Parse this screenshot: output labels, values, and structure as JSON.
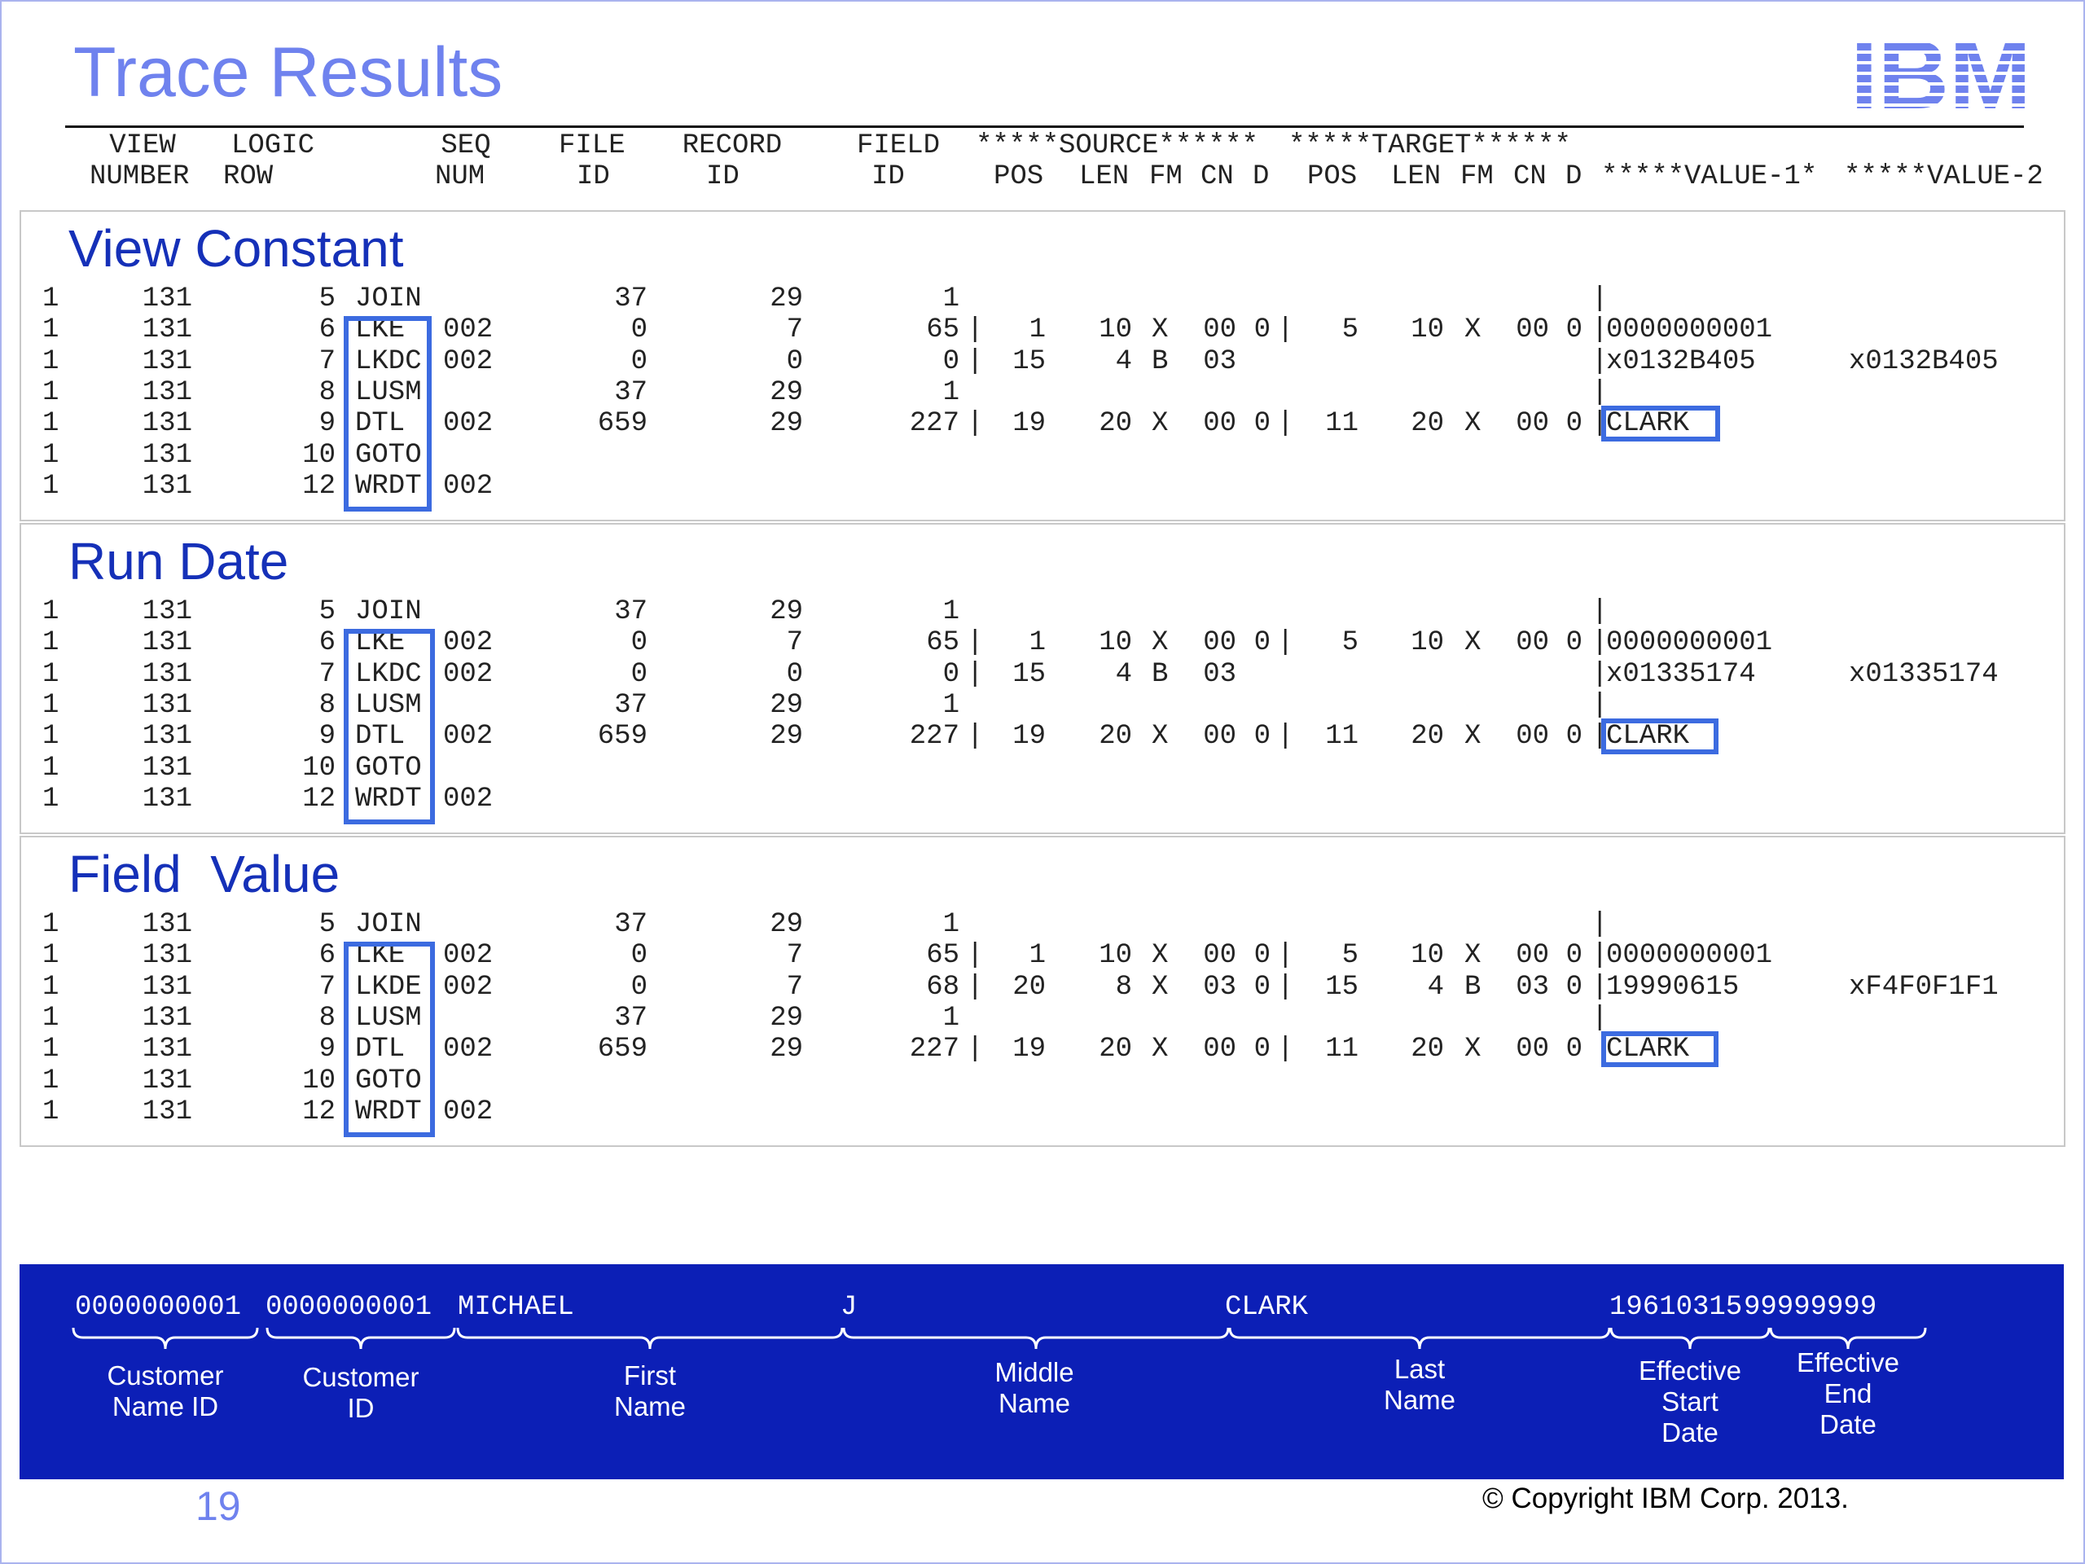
{
  "slide": {
    "title": "Trace Results",
    "logo_text": "IBM",
    "page_number": "19",
    "copyright": "© Copyright IBM Corp. 2013."
  },
  "columns": {
    "line1": [
      "VIEW",
      "LOGIC",
      "SEQ",
      "FILE",
      "RECORD",
      "FIELD",
      "*****SOURCE******",
      "*****TARGET******"
    ],
    "line2": [
      "NUMBER",
      "ROW",
      "NUM",
      "ID",
      "ID",
      "ID",
      "POS",
      "LEN",
      "FM",
      "CN",
      "D",
      "POS",
      "LEN",
      "FM",
      "CN",
      "D",
      "*****VALUE-1*",
      "*****VALUE-2"
    ]
  },
  "sections": [
    {
      "title": "View Constant",
      "rows": [
        {
          "view": "1",
          "row": "131",
          "seq": "5",
          "func": "JOIN",
          "lr": "",
          "file": "37",
          "rec": "29",
          "field": "1",
          "s_sep": "",
          "s_pos": "",
          "s_len": "",
          "s_fm": "",
          "s_cn": "",
          "s_d": "",
          "t_sep": "",
          "t_pos": "",
          "t_len": "",
          "t_fm": "",
          "t_cn": "",
          "t_d": "",
          "v_sep": "|",
          "value1": "",
          "value2": ""
        },
        {
          "view": "1",
          "row": "131",
          "seq": "6",
          "func": "LKE",
          "lr": "002",
          "file": "0",
          "rec": "7",
          "field": "65",
          "s_sep": "|",
          "s_pos": "1",
          "s_len": "10",
          "s_fm": "X",
          "s_cn": "00",
          "s_d": "0",
          "t_sep": "|",
          "t_pos": "5",
          "t_len": "10",
          "t_fm": "X",
          "t_cn": "00",
          "t_d": "0",
          "v_sep": "|",
          "value1": "0000000001",
          "value2": ""
        },
        {
          "view": "1",
          "row": "131",
          "seq": "7",
          "func": "LKDC",
          "lr": "002",
          "file": "0",
          "rec": "0",
          "field": "0",
          "s_sep": "|",
          "s_pos": "15",
          "s_len": "4",
          "s_fm": "B",
          "s_cn": "03",
          "s_d": "",
          "t_sep": "",
          "t_pos": "",
          "t_len": "",
          "t_fm": "",
          "t_cn": "",
          "t_d": "",
          "v_sep": "|",
          "value1": "x0132B405",
          "value2": "x0132B405"
        },
        {
          "view": "1",
          "row": "131",
          "seq": "8",
          "func": "LUSM",
          "lr": "",
          "file": "37",
          "rec": "29",
          "field": "1",
          "s_sep": "",
          "s_pos": "",
          "s_len": "",
          "s_fm": "",
          "s_cn": "",
          "s_d": "",
          "t_sep": "",
          "t_pos": "",
          "t_len": "",
          "t_fm": "",
          "t_cn": "",
          "t_d": "",
          "v_sep": "|",
          "value1": "",
          "value2": ""
        },
        {
          "view": "1",
          "row": "131",
          "seq": "9",
          "func": "DTL",
          "lr": "002",
          "file": "659",
          "rec": "29",
          "field": "227",
          "s_sep": "|",
          "s_pos": "19",
          "s_len": "20",
          "s_fm": "X",
          "s_cn": "00",
          "s_d": "0",
          "t_sep": "|",
          "t_pos": "11",
          "t_len": "20",
          "t_fm": "X",
          "t_cn": "00",
          "t_d": "0",
          "v_sep": "|",
          "value1": "CLARK",
          "value2": ""
        },
        {
          "view": "1",
          "row": "131",
          "seq": "10",
          "func": "GOTO",
          "lr": "",
          "file": "",
          "rec": "",
          "field": "",
          "s_sep": "",
          "s_pos": "",
          "s_len": "",
          "s_fm": "",
          "s_cn": "",
          "s_d": "",
          "t_sep": "",
          "t_pos": "",
          "t_len": "",
          "t_fm": "",
          "t_cn": "",
          "t_d": "",
          "v_sep": "",
          "value1": "",
          "value2": ""
        },
        {
          "view": "1",
          "row": "131",
          "seq": "12",
          "func": "WRDT",
          "lr": "002",
          "file": "",
          "rec": "",
          "field": "",
          "s_sep": "",
          "s_pos": "",
          "s_len": "",
          "s_fm": "",
          "s_cn": "",
          "s_d": "",
          "t_sep": "",
          "t_pos": "",
          "t_len": "",
          "t_fm": "",
          "t_cn": "",
          "t_d": "",
          "v_sep": "",
          "value1": "",
          "value2": ""
        }
      ]
    },
    {
      "title": "Run Date",
      "rows": [
        {
          "view": "1",
          "row": "131",
          "seq": "5",
          "func": "JOIN",
          "lr": "",
          "file": "37",
          "rec": "29",
          "field": "1",
          "s_sep": "",
          "s_pos": "",
          "s_len": "",
          "s_fm": "",
          "s_cn": "",
          "s_d": "",
          "t_sep": "",
          "t_pos": "",
          "t_len": "",
          "t_fm": "",
          "t_cn": "",
          "t_d": "",
          "v_sep": "|",
          "value1": "",
          "value2": ""
        },
        {
          "view": "1",
          "row": "131",
          "seq": "6",
          "func": "LKE",
          "lr": "002",
          "file": "0",
          "rec": "7",
          "field": "65",
          "s_sep": "|",
          "s_pos": "1",
          "s_len": "10",
          "s_fm": "X",
          "s_cn": "00",
          "s_d": "0",
          "t_sep": "|",
          "t_pos": "5",
          "t_len": "10",
          "t_fm": "X",
          "t_cn": "00",
          "t_d": "0",
          "v_sep": "|",
          "value1": "0000000001",
          "value2": ""
        },
        {
          "view": "1",
          "row": "131",
          "seq": "7",
          "func": "LKDC",
          "lr": "002",
          "file": "0",
          "rec": "0",
          "field": "0",
          "s_sep": "|",
          "s_pos": "15",
          "s_len": "4",
          "s_fm": "B",
          "s_cn": "03",
          "s_d": "",
          "t_sep": "",
          "t_pos": "",
          "t_len": "",
          "t_fm": "",
          "t_cn": "",
          "t_d": "",
          "v_sep": "|",
          "value1": "x01335174",
          "value2": "x01335174"
        },
        {
          "view": "1",
          "row": "131",
          "seq": "8",
          "func": "LUSM",
          "lr": "",
          "file": "37",
          "rec": "29",
          "field": "1",
          "s_sep": "",
          "s_pos": "",
          "s_len": "",
          "s_fm": "",
          "s_cn": "",
          "s_d": "",
          "t_sep": "",
          "t_pos": "",
          "t_len": "",
          "t_fm": "",
          "t_cn": "",
          "t_d": "",
          "v_sep": "|",
          "value1": "",
          "value2": ""
        },
        {
          "view": "1",
          "row": "131",
          "seq": "9",
          "func": "DTL",
          "lr": "002",
          "file": "659",
          "rec": "29",
          "field": "227",
          "s_sep": "|",
          "s_pos": "19",
          "s_len": "20",
          "s_fm": "X",
          "s_cn": "00",
          "s_d": "0",
          "t_sep": "|",
          "t_pos": "11",
          "t_len": "20",
          "t_fm": "X",
          "t_cn": "00",
          "t_d": "0",
          "v_sep": "|",
          "value1": "CLARK",
          "value2": ""
        },
        {
          "view": "1",
          "row": "131",
          "seq": "10",
          "func": "GOTO",
          "lr": "",
          "file": "",
          "rec": "",
          "field": "",
          "s_sep": "",
          "s_pos": "",
          "s_len": "",
          "s_fm": "",
          "s_cn": "",
          "s_d": "",
          "t_sep": "",
          "t_pos": "",
          "t_len": "",
          "t_fm": "",
          "t_cn": "",
          "t_d": "",
          "v_sep": "",
          "value1": "",
          "value2": ""
        },
        {
          "view": "1",
          "row": "131",
          "seq": "12",
          "func": "WRDT",
          "lr": "002",
          "file": "",
          "rec": "",
          "field": "",
          "s_sep": "",
          "s_pos": "",
          "s_len": "",
          "s_fm": "",
          "s_cn": "",
          "s_d": "",
          "t_sep": "",
          "t_pos": "",
          "t_len": "",
          "t_fm": "",
          "t_cn": "",
          "t_d": "",
          "v_sep": "",
          "value1": "",
          "value2": ""
        }
      ]
    },
    {
      "title": "Field  Value",
      "rows": [
        {
          "view": "1",
          "row": "131",
          "seq": "5",
          "func": "JOIN",
          "lr": "",
          "file": "37",
          "rec": "29",
          "field": "1",
          "s_sep": "",
          "s_pos": "",
          "s_len": "",
          "s_fm": "",
          "s_cn": "",
          "s_d": "",
          "t_sep": "",
          "t_pos": "",
          "t_len": "",
          "t_fm": "",
          "t_cn": "",
          "t_d": "",
          "v_sep": "|",
          "value1": "",
          "value2": ""
        },
        {
          "view": "1",
          "row": "131",
          "seq": "6",
          "func": "LKE",
          "lr": "002",
          "file": "0",
          "rec": "7",
          "field": "65",
          "s_sep": "|",
          "s_pos": "1",
          "s_len": "10",
          "s_fm": "X",
          "s_cn": "00",
          "s_d": "0",
          "t_sep": "|",
          "t_pos": "5",
          "t_len": "10",
          "t_fm": "X",
          "t_cn": "00",
          "t_d": "0",
          "v_sep": "|",
          "value1": "0000000001",
          "value2": ""
        },
        {
          "view": "1",
          "row": "131",
          "seq": "7",
          "func": "LKDE",
          "lr": "002",
          "file": "0",
          "rec": "7",
          "field": "68",
          "s_sep": "|",
          "s_pos": "20",
          "s_len": "8",
          "s_fm": "X",
          "s_cn": "03",
          "s_d": "0",
          "t_sep": "|",
          "t_pos": "15",
          "t_len": "4",
          "t_fm": "B",
          "t_cn": "03",
          "t_d": "0",
          "v_sep": "|",
          "value1": "19990615",
          "value2": "xF4F0F1F1"
        },
        {
          "view": "1",
          "row": "131",
          "seq": "8",
          "func": "LUSM",
          "lr": "",
          "file": "37",
          "rec": "29",
          "field": "1",
          "s_sep": "",
          "s_pos": "",
          "s_len": "",
          "s_fm": "",
          "s_cn": "",
          "s_d": "",
          "t_sep": "",
          "t_pos": "",
          "t_len": "",
          "t_fm": "",
          "t_cn": "",
          "t_d": "",
          "v_sep": "|",
          "value1": "",
          "value2": ""
        },
        {
          "view": "1",
          "row": "131",
          "seq": "9",
          "func": "DTL",
          "lr": "002",
          "file": "659",
          "rec": "29",
          "field": "227",
          "s_sep": "|",
          "s_pos": "19",
          "s_len": "20",
          "s_fm": "X",
          "s_cn": "00",
          "s_d": "0",
          "t_sep": "|",
          "t_pos": "11",
          "t_len": "20",
          "t_fm": "X",
          "t_cn": "00",
          "t_d": "0",
          "v_sep": "",
          "value1": "CLARK",
          "value2": ""
        },
        {
          "view": "1",
          "row": "131",
          "seq": "10",
          "func": "GOTO",
          "lr": "",
          "file": "",
          "rec": "",
          "field": "",
          "s_sep": "",
          "s_pos": "",
          "s_len": "",
          "s_fm": "",
          "s_cn": "",
          "s_d": "",
          "t_sep": "",
          "t_pos": "",
          "t_len": "",
          "t_fm": "",
          "t_cn": "",
          "t_d": "",
          "v_sep": "",
          "value1": "",
          "value2": ""
        },
        {
          "view": "1",
          "row": "131",
          "seq": "12",
          "func": "WRDT",
          "lr": "002",
          "file": "",
          "rec": "",
          "field": "",
          "s_sep": "",
          "s_pos": "",
          "s_len": "",
          "s_fm": "",
          "s_cn": "",
          "s_d": "",
          "t_sep": "",
          "t_pos": "",
          "t_len": "",
          "t_fm": "",
          "t_cn": "",
          "t_d": "",
          "v_sep": "",
          "value1": "",
          "value2": ""
        }
      ]
    }
  ],
  "record_bar": {
    "segments": [
      "0000000001",
      "0000000001",
      "MICHAEL",
      "J",
      "CLARK",
      "19610315",
      "99999999"
    ],
    "labels": [
      "Customer\nName ID",
      "Customer\nID",
      "First\nName",
      "Middle\nName",
      "Last\nName",
      "Effective\nStart\nDate",
      "Effective\nEnd\nDate"
    ]
  },
  "colors": {
    "title": "#6f82ee",
    "section_title": "#1530b8",
    "highlight_box": "#3c6be0",
    "record_bar": "#0c1fb6",
    "page_number": "#6f82ee"
  }
}
